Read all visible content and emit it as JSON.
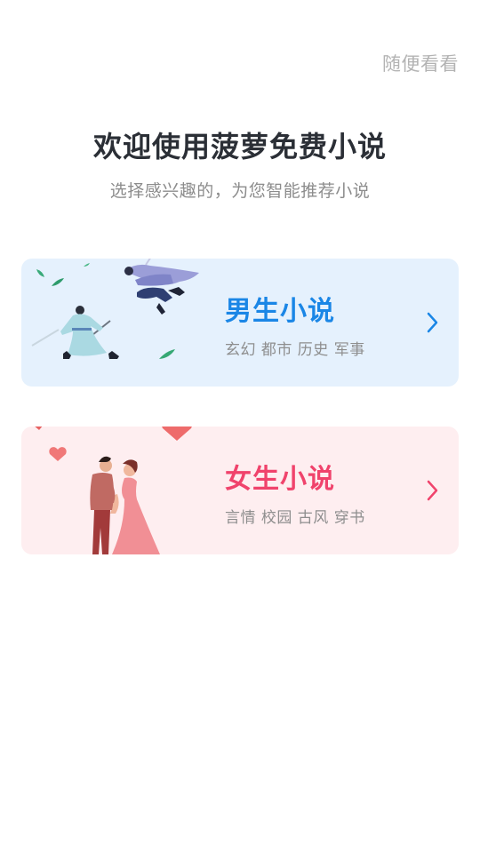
{
  "header": {
    "skip_label": "随便看看",
    "title": "欢迎使用菠萝免费小说",
    "subtitle": "选择感兴趣的，为您智能推荐小说"
  },
  "cards": [
    {
      "title": "男生小说",
      "tags": "玄幻 都市 历史 军事",
      "accent": "#1a86e6",
      "background": "#e5f1fd",
      "illustration": "two-swordsmen-illustration",
      "arrow_icon": "chevron-right-icon"
    },
    {
      "title": "女生小说",
      "tags": "言情 校园 古风 穿书",
      "accent": "#f0436c",
      "background": "#feeef0",
      "illustration": "couple-hearts-illustration",
      "arrow_icon": "chevron-right-icon"
    }
  ]
}
